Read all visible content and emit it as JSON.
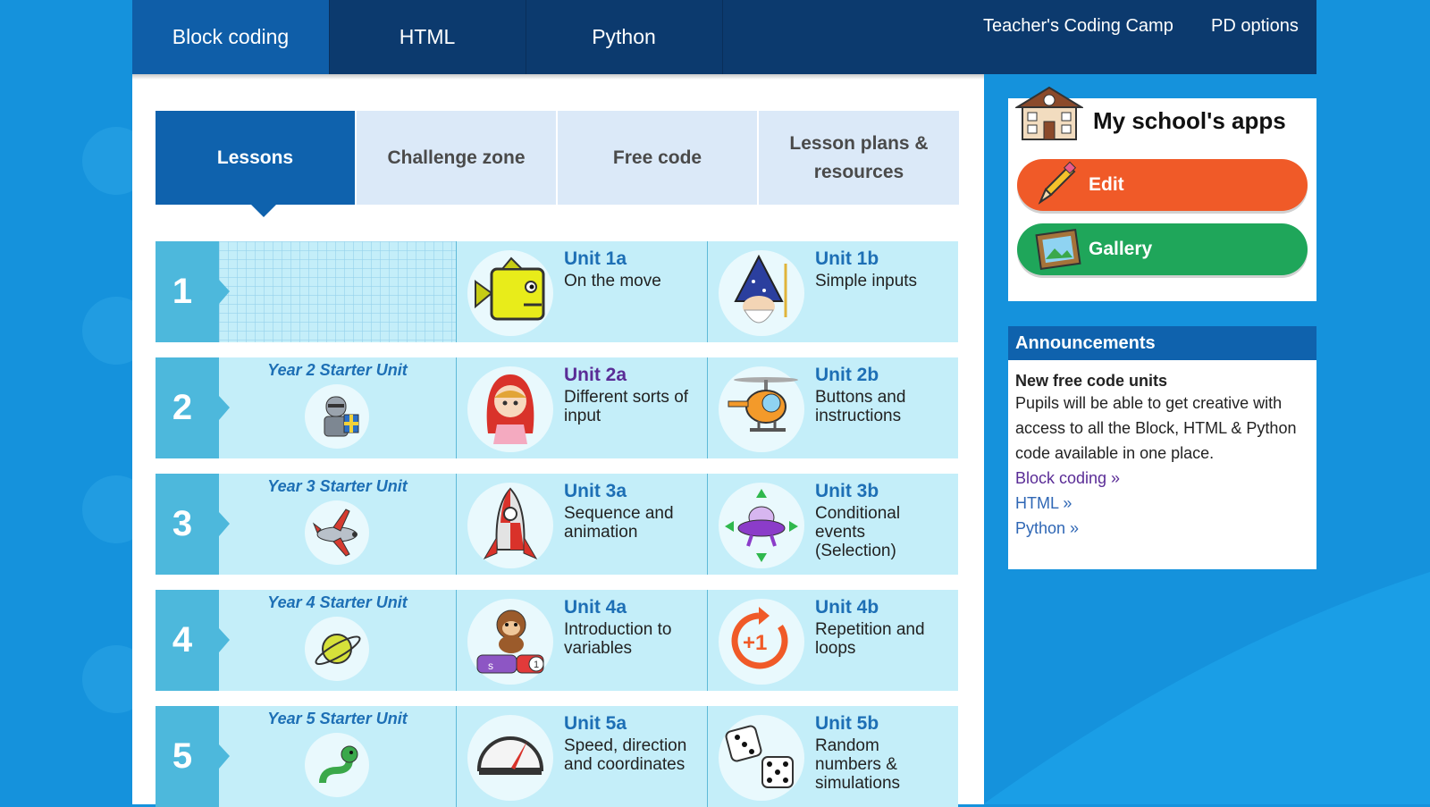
{
  "top_tabs": [
    "Block coding",
    "HTML",
    "Python"
  ],
  "top_links": [
    "Teacher's Coding Camp",
    "PD options"
  ],
  "sub_tabs": [
    "Lessons",
    "Challenge zone",
    "Free code",
    "Lesson plans & resources"
  ],
  "rows": [
    {
      "num": "1",
      "starter": "",
      "a": {
        "title": "Unit 1a",
        "desc": "On the move",
        "icon": "fish-icon"
      },
      "b": {
        "title": "Unit 1b",
        "desc": "Simple inputs",
        "icon": "wizard-icon"
      }
    },
    {
      "num": "2",
      "starter": "Year 2 Starter Unit",
      "a": {
        "title": "Unit 2a",
        "desc": "Different sorts of input",
        "icon": "red-riding-hood-icon"
      },
      "b": {
        "title": "Unit 2b",
        "desc": "Buttons and instructions",
        "icon": "helicopter-icon"
      }
    },
    {
      "num": "3",
      "starter": "Year 3 Starter Unit",
      "a": {
        "title": "Unit 3a",
        "desc": "Sequence and animation",
        "icon": "rocket-icon"
      },
      "b": {
        "title": "Unit 3b",
        "desc": "Conditional events (Selection)",
        "icon": "ufo-icon"
      }
    },
    {
      "num": "4",
      "starter": "Year 4 Starter Unit",
      "a": {
        "title": "Unit 4a",
        "desc": "Introduction to variables",
        "icon": "monkey-icon"
      },
      "b": {
        "title": "Unit 4b",
        "desc": "Repetition and loops",
        "icon": "loop-plus-one-icon"
      }
    },
    {
      "num": "5",
      "starter": "Year 5 Starter Unit",
      "a": {
        "title": "Unit 5a",
        "desc": "Speed, direction and coordinates",
        "icon": "speedometer-icon"
      },
      "b": {
        "title": "Unit 5b",
        "desc": "Random numbers & simulations",
        "icon": "dice-icon"
      }
    }
  ],
  "apps": {
    "title": "My school's apps",
    "edit": "Edit",
    "gallery": "Gallery"
  },
  "announcements": {
    "heading": "Announcements",
    "title": "New free code units",
    "body": "Pupils will be able to get creative with access to all the Block, HTML & Python code available in one place.",
    "links": [
      "Block coding »",
      "HTML »",
      "Python »"
    ]
  },
  "colors": {
    "nav": "#0c3a6e",
    "active": "#0f62ad",
    "row": "#c4eef9",
    "number": "#4db8dc",
    "edit": "#f05a28",
    "gallery": "#1fa65a"
  }
}
